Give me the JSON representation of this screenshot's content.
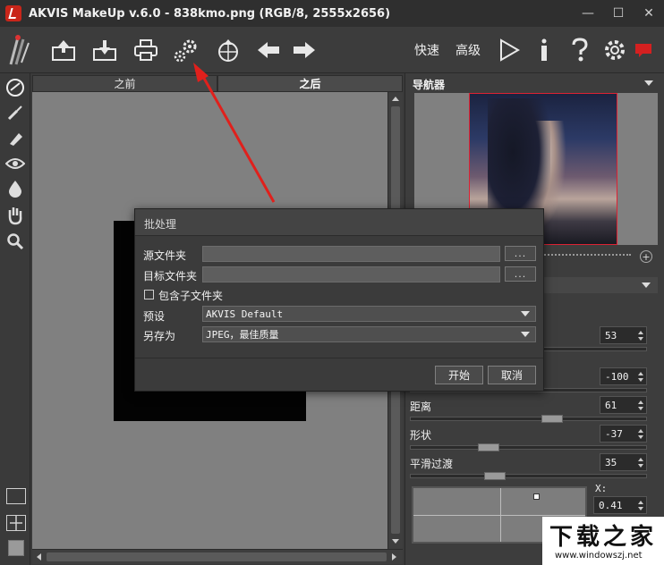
{
  "window": {
    "title": "AKVIS MakeUp v.6.0 - 838kmo.png (RGB/8, 2555x2656)",
    "controls": [
      "—",
      "☐",
      "✕"
    ]
  },
  "toolbar": {
    "quick_label": "快速",
    "advanced_label": "高级",
    "icons": [
      "akvis-logo-icon",
      "open-icon",
      "save-icon",
      "print-icon",
      "batch-processing-icon",
      "export-icon",
      "undo-arrow-icon",
      "redo-arrow-icon",
      "run-icon",
      "info-icon",
      "help-icon",
      "settings-icon",
      "feedback-icon"
    ]
  },
  "canvas": {
    "tab_before": "之前",
    "tab_after": "之后",
    "active_tab": "之后"
  },
  "navigator": {
    "title": "导航器"
  },
  "params": {
    "p1_value": "53",
    "p2_value": "-100",
    "distance_label": "距离",
    "distance_value": "61",
    "shape_label": "形状",
    "shape_value": "-37",
    "smooth_label": "平滑过渡",
    "smooth_value": "35",
    "x_label": "X:",
    "x_value": "0.41"
  },
  "dialog": {
    "title": "批处理",
    "source_label": "源文件夹",
    "target_label": "目标文件夹",
    "browse": "...",
    "include_sub_label": "包含子文件夹",
    "include_sub_checked": false,
    "preset_label": "预设",
    "preset_value": "AKVIS Default",
    "saveas_label": "另存为",
    "saveas_value": "JPEG，最佳质量",
    "start_button": "开始",
    "cancel_button": "取消"
  },
  "watermark": {
    "main": "下载之家",
    "url": "www.windowszj.net"
  },
  "colors": {
    "annotation_arrow": "#e0201c",
    "feedback_icon": "#d42020",
    "canvas_bg": "#808080"
  }
}
